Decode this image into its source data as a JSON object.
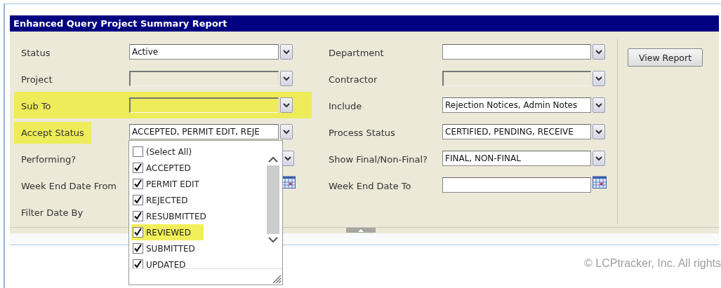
{
  "window": {
    "title": "Enhanced Query Project Summary Report"
  },
  "left_fields": [
    {
      "label": "Status",
      "kind": "select",
      "value": "Active",
      "disabled": false,
      "row_highlighted": false,
      "label_highlighted": false
    },
    {
      "label": "Project",
      "kind": "select",
      "disabled": true,
      "row_highlighted": false,
      "label_highlighted": false
    },
    {
      "label": "Sub To",
      "kind": "select",
      "disabled": true,
      "row_highlighted": true,
      "label_highlighted": false
    },
    {
      "label": "Accept Status",
      "kind": "select",
      "value": "ACCEPTED, PERMIT EDIT, REJE",
      "disabled": false,
      "row_highlighted": false,
      "label_highlighted": true
    },
    {
      "label": "Performing?",
      "kind": "select-covered",
      "row_highlighted": false,
      "label_highlighted": false
    },
    {
      "label": "Week End Date From",
      "kind": "date-covered",
      "row_highlighted": false,
      "label_highlighted": false
    },
    {
      "label": "Filter Date By",
      "kind": "label-only",
      "row_highlighted": false,
      "label_highlighted": false
    }
  ],
  "right_fields": [
    {
      "label": "Department",
      "kind": "select",
      "disabled": false
    },
    {
      "label": "Contractor",
      "kind": "select",
      "disabled": true
    },
    {
      "label": "Include",
      "kind": "select",
      "value": "Rejection Notices, Admin Notes",
      "disabled": false
    },
    {
      "label": "Process Status",
      "kind": "select",
      "value": "CERTIFIED, PENDING, RECEIVE",
      "disabled": false
    },
    {
      "label": "Show Final/Non-Final?",
      "kind": "select",
      "value": "FINAL, NON-FINAL",
      "disabled": false
    },
    {
      "label": "Week End Date To",
      "kind": "date"
    }
  ],
  "view_button": "View Report",
  "accept_options": [
    {
      "label": "(Select All)",
      "checked": false,
      "highlighted": false
    },
    {
      "label": "ACCEPTED",
      "checked": true,
      "highlighted": false
    },
    {
      "label": "PERMIT EDIT",
      "checked": true,
      "highlighted": false
    },
    {
      "label": "REJECTED",
      "checked": true,
      "highlighted": false
    },
    {
      "label": "RESUBMITTED",
      "checked": true,
      "highlighted": false
    },
    {
      "label": "REVIEWED",
      "checked": true,
      "highlighted": true
    },
    {
      "label": "SUBMITTED",
      "checked": true,
      "highlighted": false
    },
    {
      "label": "UPDATED",
      "checked": true,
      "highlighted": false
    }
  ],
  "copyright": "© LCPtracker, Inc. All rights"
}
